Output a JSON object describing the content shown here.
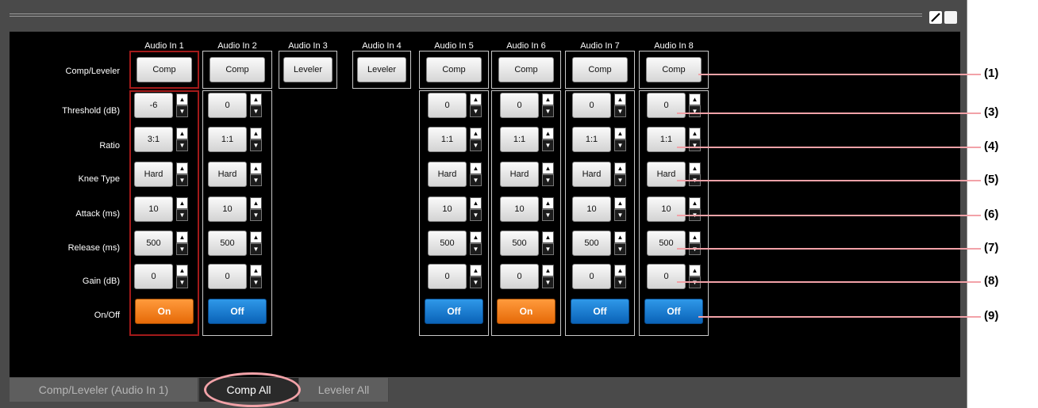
{
  "columns": [
    {
      "name": "Audio In 1",
      "mode": "Comp",
      "params": [
        "-6",
        "3:1",
        "Hard",
        "10",
        "500",
        "0"
      ],
      "state": "On"
    },
    {
      "name": "Audio In 2",
      "mode": "Comp",
      "params": [
        "0",
        "1:1",
        "Hard",
        "10",
        "500",
        "0"
      ],
      "state": "Off"
    },
    {
      "name": "Audio In 3",
      "mode": "Leveler",
      "params": null,
      "state": null
    },
    {
      "name": "Audio In 4",
      "mode": "Leveler",
      "params": null,
      "state": null
    },
    {
      "name": "Audio In 5",
      "mode": "Comp",
      "params": [
        "0",
        "1:1",
        "Hard",
        "10",
        "500",
        "0"
      ],
      "state": "Off"
    },
    {
      "name": "Audio In 6",
      "mode": "Comp",
      "params": [
        "0",
        "1:1",
        "Hard",
        "10",
        "500",
        "0"
      ],
      "state": "On"
    },
    {
      "name": "Audio In 7",
      "mode": "Comp",
      "params": [
        "0",
        "1:1",
        "Hard",
        "10",
        "500",
        "0"
      ],
      "state": "Off"
    },
    {
      "name": "Audio In 8",
      "mode": "Comp",
      "params": [
        "0",
        "1:1",
        "Hard",
        "10",
        "500",
        "0"
      ],
      "state": "Off"
    }
  ],
  "row_labels": {
    "mode": "Comp/Leveler",
    "params": [
      "Threshold (dB)",
      "Ratio",
      "Knee Type",
      "Attack (ms)",
      "Release (ms)",
      "Gain (dB)"
    ],
    "state": "On/Off"
  },
  "callouts": [
    "(1)",
    "(3)",
    "(4)",
    "(5)",
    "(6)",
    "(7)",
    "(8)",
    "(9)"
  ],
  "tabs": [
    {
      "label": "Comp/Leveler (Audio In 1)",
      "active": false
    },
    {
      "label": "Comp All",
      "active": true
    },
    {
      "label": "Leveler All",
      "active": false
    }
  ],
  "selected_column": "Audio In 1",
  "colors": {
    "on": "#f07a14",
    "off": "#1277cc",
    "selection": "#a31a1a",
    "callout": "#f2a2a8"
  },
  "icons": {
    "edit": "pencil-icon",
    "window": "window-icon"
  }
}
